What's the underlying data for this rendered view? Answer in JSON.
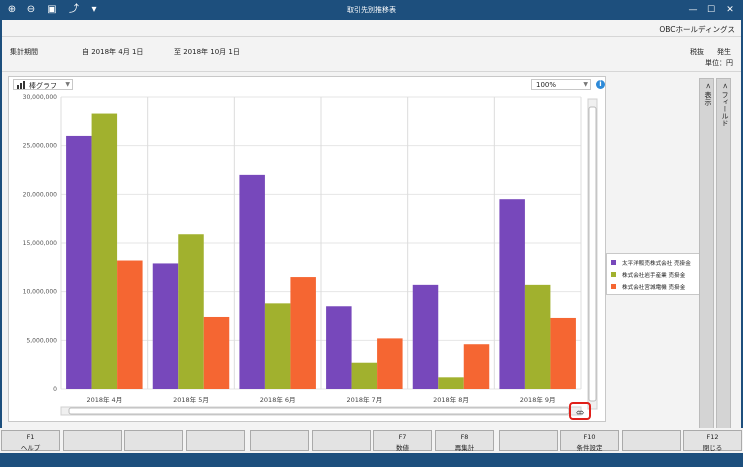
{
  "window": {
    "title": "取引先別推移表",
    "company": "OBCホールディングス"
  },
  "header": {
    "period_label": "集計期間",
    "from": "自 2018年 4月 1日",
    "to": "至 2018年 10月 1日",
    "tax": "税抜",
    "occurrence": "発生",
    "unit": "単位：円"
  },
  "toolbar": {
    "chart_type": "棒グラフ",
    "zoom": "100%"
  },
  "side_tabs": {
    "display": "< 表示",
    "field": "< フィールド"
  },
  "colors": {
    "series1": "#7748bb",
    "series2": "#a1b12e",
    "series3": "#f56632",
    "titlebar": "#1d4f7d"
  },
  "icons": [
    "zoom-in-icon",
    "zoom-out-icon",
    "print-icon",
    "export-icon",
    "dropdown-icon"
  ],
  "chart_data": {
    "type": "bar",
    "categories": [
      "2018年 4月",
      "2018年 5月",
      "2018年 6月",
      "2018年 7月",
      "2018年 8月",
      "2018年 9月"
    ],
    "series": [
      {
        "name": "太平洋販売株式会社 売掛金",
        "values": [
          26000000,
          12900000,
          22000000,
          8500000,
          10700000,
          19500000
        ]
      },
      {
        "name": "株式会社岩手産業 売掛金",
        "values": [
          28300000,
          15900000,
          8800000,
          2700000,
          1200000,
          10700000
        ]
      },
      {
        "name": "株式会社宮城電機 売掛金",
        "values": [
          13200000,
          7400000,
          11500000,
          5200000,
          4600000,
          7300000
        ]
      }
    ],
    "yticks": [
      "30,000,000",
      "25,000,000",
      "20,000,000",
      "15,000,000",
      "10,000,000",
      "5,000,000",
      "0"
    ],
    "ylim": [
      0,
      30000000
    ],
    "grid": true,
    "legend": "right",
    "title": "",
    "xlabel": "",
    "ylabel": ""
  },
  "fkeys": [
    {
      "key": "F1",
      "label": "ヘルプ"
    },
    {
      "key": "",
      "label": ""
    },
    {
      "key": "",
      "label": ""
    },
    {
      "key": "",
      "label": ""
    },
    {
      "key": "",
      "label": ""
    },
    {
      "key": "",
      "label": ""
    },
    {
      "key": "F7",
      "label": "数値"
    },
    {
      "key": "F8",
      "label": "再集計"
    },
    {
      "key": "",
      "label": ""
    },
    {
      "key": "F10",
      "label": "条件設定"
    },
    {
      "key": "",
      "label": ""
    },
    {
      "key": "F12",
      "label": "閉じる"
    }
  ]
}
